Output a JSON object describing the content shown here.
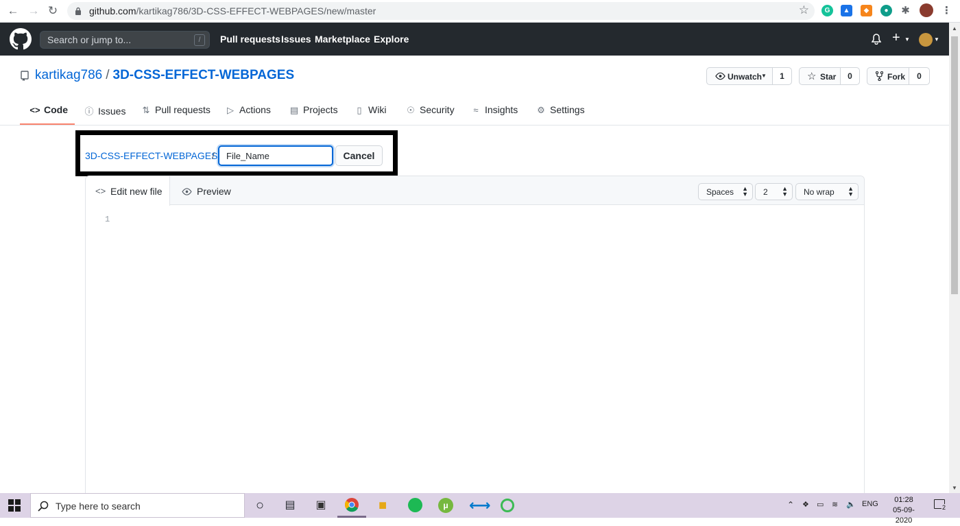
{
  "browser": {
    "url_host": "github.com",
    "url_path": "/kartikag786/3D-CSS-EFFECT-WEBPAGES/new/master",
    "icons": [
      "back-arrow-icon",
      "forward-arrow-icon",
      "reload-icon",
      "lock-icon",
      "bookmark-star-icon",
      "grammarly-icon",
      "extension-icon",
      "metamask-icon",
      "extension-icon",
      "puzzle-icon",
      "profile-avatar",
      "menu-kebab-icon"
    ]
  },
  "github_header": {
    "search_placeholder": "Search or jump to...",
    "search_shortcut": "/",
    "nav": [
      "Pull requests",
      "Issues",
      "Marketplace",
      "Explore"
    ],
    "plus": "+"
  },
  "repo": {
    "owner": "kartikag786",
    "separator": "/",
    "name": "3D-CSS-EFFECT-WEBPAGES",
    "unwatch_label": "Unwatch",
    "unwatch_count": "1",
    "star_label": "Star",
    "star_count": "0",
    "fork_label": "Fork",
    "fork_count": "0"
  },
  "tabs": {
    "code": "Code",
    "issues": "Issues",
    "pull_requests": "Pull requests",
    "actions": "Actions",
    "projects": "Projects",
    "wiki": "Wiki",
    "security": "Security",
    "insights": "Insights",
    "settings": "Settings"
  },
  "new_file": {
    "breadcrumb_repo": "3D-CSS-EFFECT-WEBPAGES",
    "breadcrumb_sep": "/",
    "filename_value": "File_Name",
    "cancel_label": "Cancel"
  },
  "editor": {
    "edit_tab": "Edit new file",
    "preview_tab": "Preview",
    "indent_mode": "Spaces",
    "indent_size": "2",
    "wrap_mode": "No wrap",
    "line_number": "1"
  },
  "taskbar": {
    "search_placeholder": "Type here to search",
    "language": "ENG",
    "time": "01:28",
    "date": "05-09-2020",
    "notification_count": "2"
  },
  "colors": {
    "github_header_bg": "#24292e",
    "link_blue": "#0366d6",
    "active_tab_underline": "#f9826c",
    "taskbar_bg": "#ddd3e6"
  }
}
